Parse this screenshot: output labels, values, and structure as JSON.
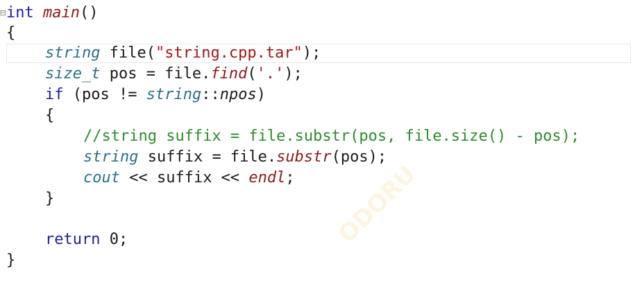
{
  "code": {
    "l1": {
      "kw": "int",
      "fn": "main",
      "rest": "()"
    },
    "l2": "{",
    "l3": {
      "type": "string",
      "ident": " file(",
      "str": "\"string.cpp.tar\"",
      "tail": ");"
    },
    "l4": {
      "type": "size_t",
      "mid": " pos = file.",
      "fn": "find",
      "open": "(",
      "str": "'.'",
      "tail": ");"
    },
    "l5": {
      "kw": "if",
      "mid": " (pos != ",
      "type": "string",
      "sep": "::",
      "member": "npos",
      "tail": ")"
    },
    "l6": "{",
    "l7": "//string suffix = file.substr(pos, file.size() - pos);",
    "l8": {
      "type": "string",
      "mid": " suffix = file.",
      "fn": "substr",
      "tail": "(pos);"
    },
    "l9": {
      "type": "cout",
      "mid": " << suffix << ",
      "fn": "endl",
      "tail": ";"
    },
    "l10": "}",
    "l11": {
      "kw": "return",
      "mid": " ",
      "num": "0",
      "tail": ";"
    },
    "l12": "}"
  },
  "fold_marker": "⊟",
  "watermark": "ODORU"
}
